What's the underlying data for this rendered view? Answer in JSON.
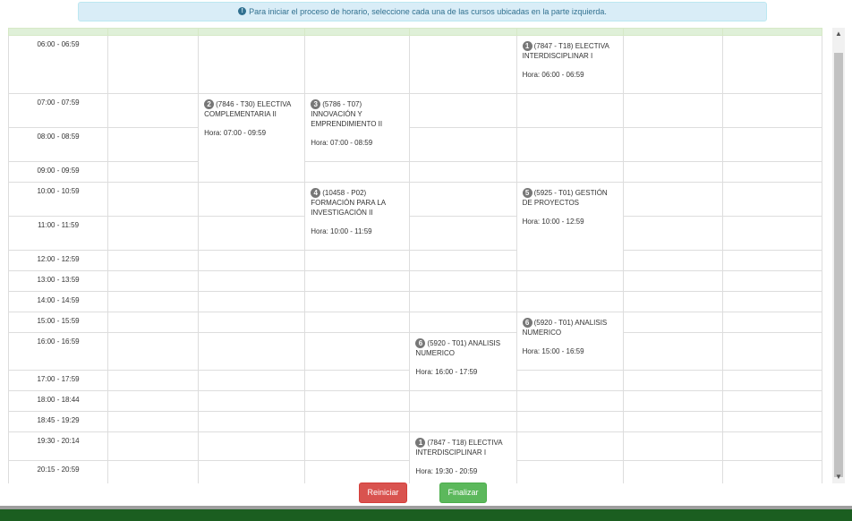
{
  "alert": {
    "icon": "info-circle-icon",
    "text": "Para iniciar el proceso de horario, seleccione cada una de las cursos ubicadas en la parte izquierda."
  },
  "time_slots": [
    "06:00 - 06:59",
    "07:00 - 07:59",
    "08:00 - 08:59",
    "09:00 - 09:59",
    "10:00 - 10:59",
    "11:00 - 11:59",
    "12:00 - 12:59",
    "13:00 - 13:59",
    "14:00 - 14:59",
    "15:00 - 15:59",
    "16:00 - 16:59",
    "17:00 - 17:59",
    "18:00 - 18:44",
    "18:45 - 19:29",
    "19:30 - 20:14",
    "20:15 - 20:59"
  ],
  "courses": [
    {
      "num": "1",
      "title": "(7847 - T18) ELECTIVA INTERDISCIPLINAR I",
      "hora": "Hora: 06:00 - 06:59"
    },
    {
      "num": "2",
      "title": "(7846 - T30) ELECTIVA COMPLEMENTARIA II",
      "hora": "Hora: 07:00 - 09:59"
    },
    {
      "num": "3",
      "title": "(5786 - T07) INNOVACIÓN Y EMPRENDIMIENTO II",
      "hora": "Hora: 07:00 - 08:59"
    },
    {
      "num": "4",
      "title": "(10458 - P02) FORMACIÓN PARA LA INVESTIGACIÓN II",
      "hora": "Hora: 10:00 - 11:59"
    },
    {
      "num": "5",
      "title": "(5925 - T01) GESTIÓN DE PROYECTOS",
      "hora": "Hora: 10:00 - 12:59"
    },
    {
      "num": "6",
      "title": "(5920 - T01) ANALISIS NUMERICO",
      "hora": "Hora: 15:00 - 16:59"
    },
    {
      "num": "6",
      "title": "(5920 - T01) ANALISIS NUMERICO",
      "hora": "Hora: 16:00 - 17:59"
    },
    {
      "num": "1",
      "title": "(7847 - T18) ELECTIVA INTERDISCIPLINAR I",
      "hora": "Hora: 19:30 - 20:59"
    }
  ],
  "buttons": {
    "reiniciar": "Reiniciar",
    "finalizar": "Finalizar"
  },
  "scrollbar": {
    "up_icon": "arrow-up-icon",
    "down_icon": "arrow-down-icon"
  }
}
